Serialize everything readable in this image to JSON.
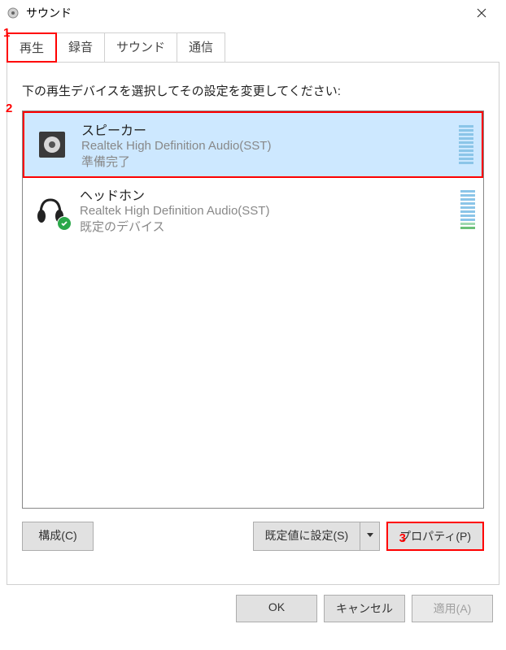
{
  "window": {
    "title": "サウンド"
  },
  "tabs": {
    "playback": "再生",
    "recording": "録音",
    "sounds": "サウンド",
    "communications": "通信"
  },
  "instruction": "下の再生デバイスを選択してその設定を変更してください:",
  "devices": [
    {
      "name": "スピーカー",
      "driver": "Realtek High Definition Audio(SST)",
      "status": "準備完了",
      "selected": true,
      "default": false
    },
    {
      "name": "ヘッドホン",
      "driver": "Realtek High Definition Audio(SST)",
      "status": "既定のデバイス",
      "selected": false,
      "default": true
    }
  ],
  "buttons": {
    "configure": "構成(C)",
    "set_default": "既定値に設定(S)",
    "properties": "プロパティ(P)",
    "ok": "OK",
    "cancel": "キャンセル",
    "apply": "適用(A)"
  },
  "annotations": {
    "a1": "1",
    "a2": "2",
    "a3": "3"
  }
}
